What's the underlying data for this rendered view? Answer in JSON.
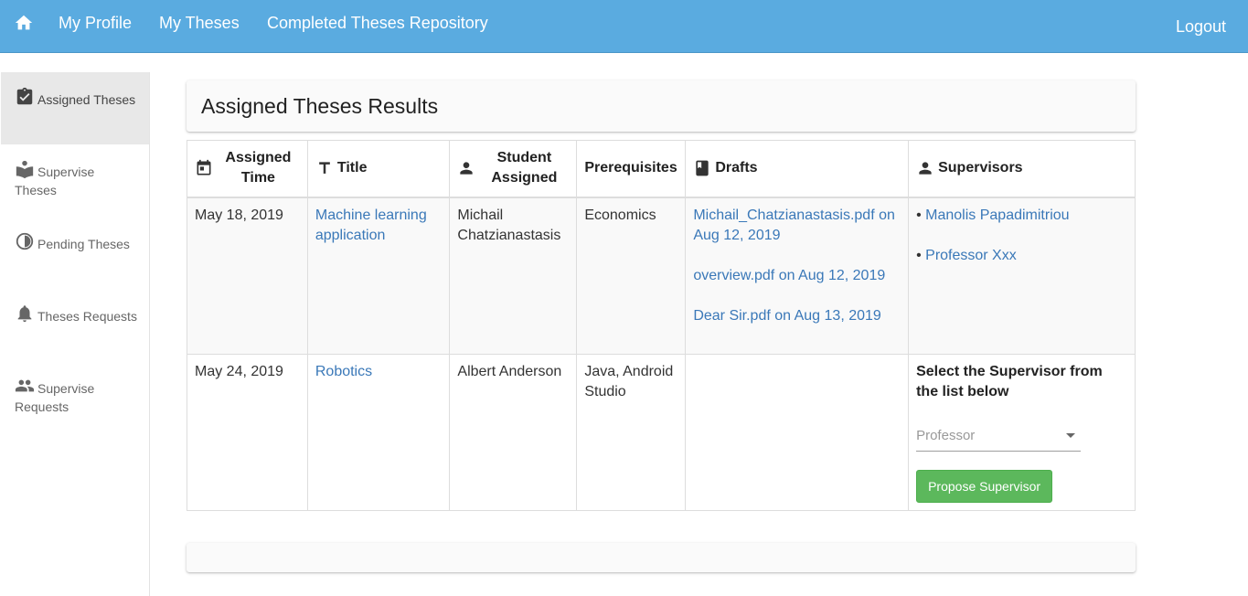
{
  "nav": {
    "home_icon": "home-icon",
    "links": [
      "My Profile",
      "My Theses",
      "Completed Theses Repository"
    ],
    "logout": "Logout"
  },
  "sidebar": {
    "items": [
      {
        "label": "Assigned Theses",
        "icon": "clipboard-check-icon",
        "active": true
      },
      {
        "label": "Supervise Theses",
        "icon": "book-reader-icon",
        "active": false
      },
      {
        "label": "Pending Theses",
        "icon": "half-circle-icon",
        "active": false
      },
      {
        "label": "Theses Requests",
        "icon": "bell-icon",
        "active": false
      },
      {
        "label": "Supervise Requests",
        "icon": "people-icon",
        "active": false
      }
    ]
  },
  "results": {
    "title": "Assigned Theses Results"
  },
  "table": {
    "headers": {
      "assigned_time": "Assigned Time",
      "title": "Title",
      "student": "Student Assigned",
      "prerequisites": "Prerequisites",
      "drafts": "Drafts",
      "supervisors": "Supervisors"
    },
    "rows": [
      {
        "assigned_time": "May 18, 2019",
        "title": "Machine learning application",
        "student": "Michail Chatzianastasis",
        "prerequisites": "Economics",
        "drafts": [
          "Michail_Chatzianastasis.pdf on Aug 12, 2019",
          "overview.pdf on Aug 12, 2019",
          "Dear Sir.pdf on Aug 13, 2019"
        ],
        "supervisors": [
          "Manolis Papadimitriou",
          "Professor Xxx"
        ]
      },
      {
        "assigned_time": "May 24, 2019",
        "title": "Robotics",
        "student": "Albert Anderson",
        "prerequisites": "Java, Android Studio",
        "drafts": [],
        "select_label": "Select the Supervisor from the list below",
        "select_value": "Professor",
        "propose_button": "Propose Supervisor"
      }
    ]
  },
  "colors": {
    "nav_bg": "#5aabe0",
    "link": "#3a78b8",
    "button_green": "#5cb85c"
  }
}
